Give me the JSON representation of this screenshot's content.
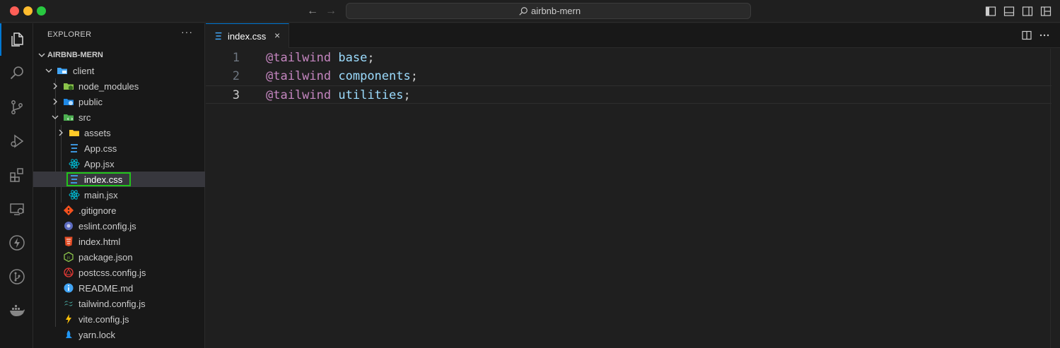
{
  "window": {
    "search_text": "airbnb-mern"
  },
  "sidebar": {
    "title": "EXPLORER",
    "more": "···",
    "root": "AIRBNB-MERN",
    "tree": [
      {
        "label": "client",
        "kind": "folder-client",
        "open": true
      },
      {
        "label": "node_modules",
        "kind": "folder-node",
        "open": false
      },
      {
        "label": "public",
        "kind": "folder-public",
        "open": false
      },
      {
        "label": "src",
        "kind": "folder-src",
        "open": true
      },
      {
        "label": "assets",
        "kind": "folder-assets",
        "open": false
      },
      {
        "label": "App.css",
        "kind": "css"
      },
      {
        "label": "App.jsx",
        "kind": "react"
      },
      {
        "label": "index.css",
        "kind": "css",
        "selected": true
      },
      {
        "label": "main.jsx",
        "kind": "react"
      },
      {
        "label": ".gitignore",
        "kind": "git"
      },
      {
        "label": "eslint.config.js",
        "kind": "eslint"
      },
      {
        "label": "index.html",
        "kind": "html"
      },
      {
        "label": "package.json",
        "kind": "json"
      },
      {
        "label": "postcss.config.js",
        "kind": "postcss"
      },
      {
        "label": "README.md",
        "kind": "info"
      },
      {
        "label": "tailwind.config.js",
        "kind": "tailwind"
      },
      {
        "label": "vite.config.js",
        "kind": "vite"
      },
      {
        "label": "yarn.lock",
        "kind": "yarn"
      }
    ]
  },
  "editor": {
    "tab_label": "index.css",
    "tab_close": "×",
    "lines": [
      {
        "num": "1",
        "kw": "@tailwind",
        "id": "base",
        "punc": ";"
      },
      {
        "num": "2",
        "kw": "@tailwind",
        "id": "components",
        "punc": ";"
      },
      {
        "num": "3",
        "kw": "@tailwind",
        "id": "utilities",
        "punc": ";"
      }
    ]
  },
  "colors": {
    "accent": "#0078d4",
    "selection_outline": "#22c31b",
    "keyword": "#c586c0",
    "identifier": "#9cdcfe"
  }
}
